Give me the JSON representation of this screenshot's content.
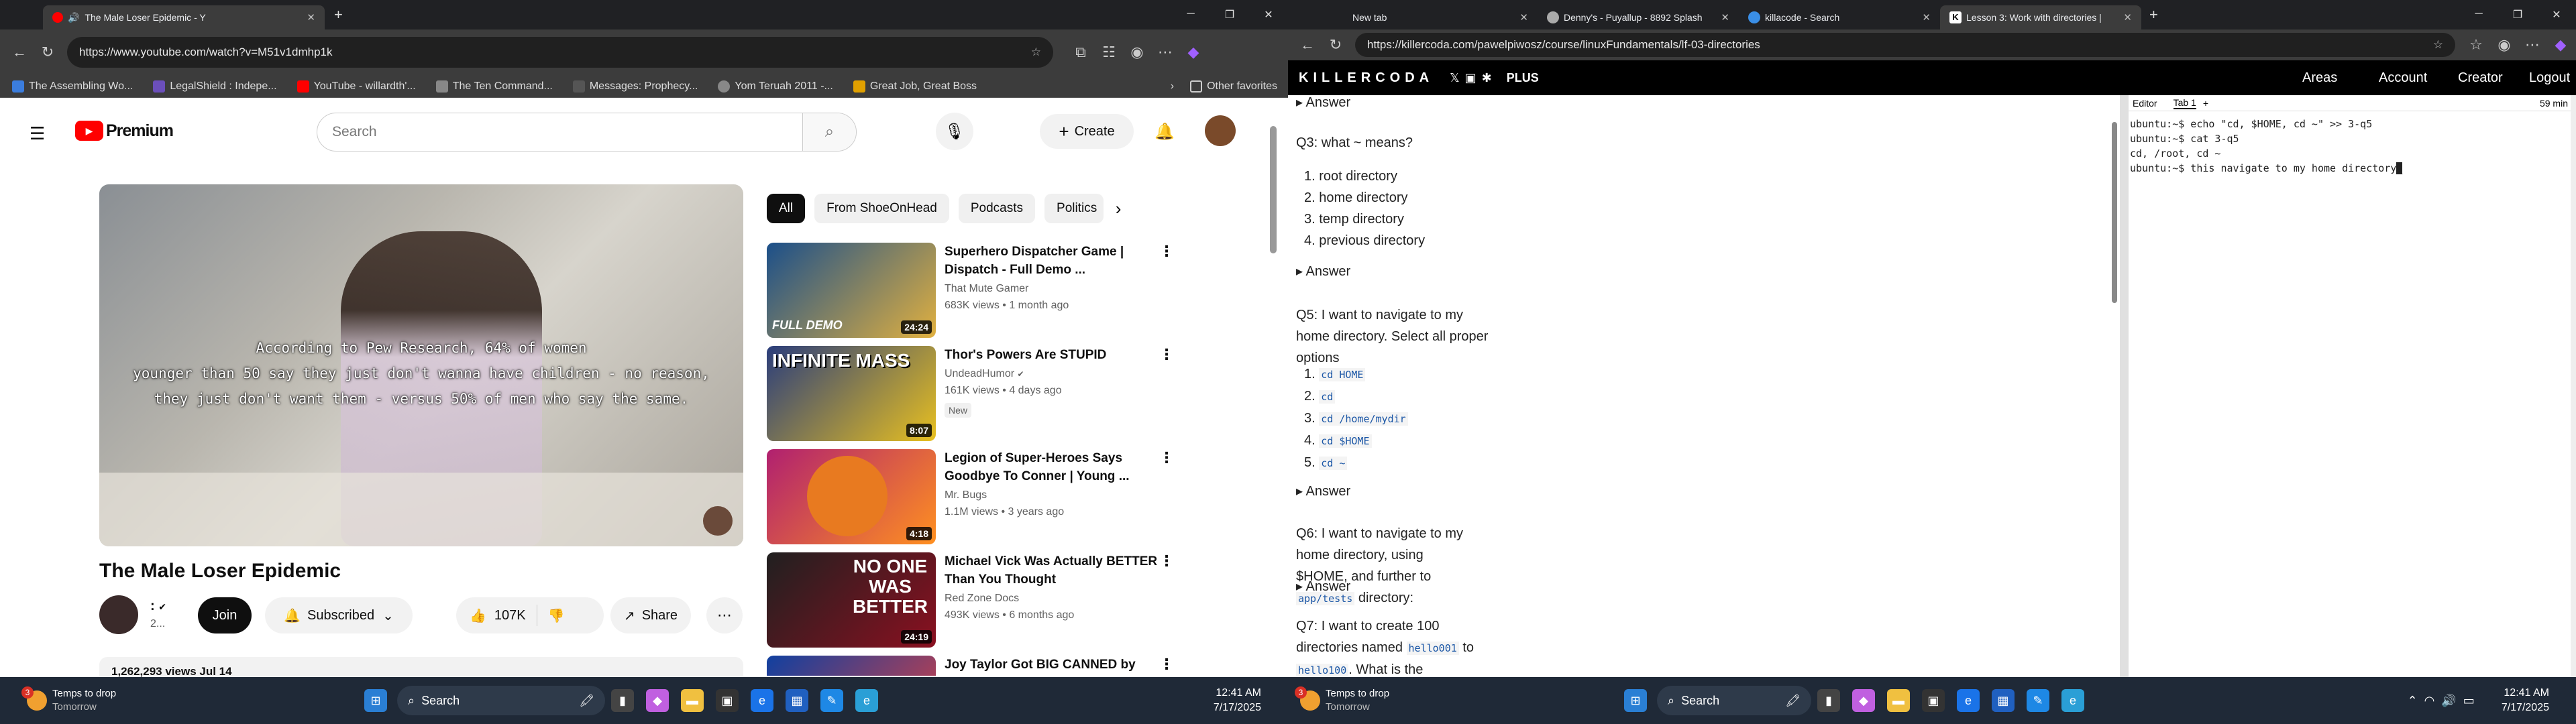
{
  "left_browser": {
    "tab_title": "The Male Loser Epidemic - Y",
    "url": "https://www.youtube.com/watch?v=M51v1dmhp1k",
    "favorites": [
      {
        "label": "The Assembling Wo...",
        "color": "#3b7ddd"
      },
      {
        "label": "LegalShield : Indepe...",
        "color": "#6b4fbb"
      },
      {
        "label": "YouTube - willardth'...",
        "color": "#ff0000"
      },
      {
        "label": "The Ten Command...",
        "color": "#888888"
      },
      {
        "label": "Messages: Prophecy...",
        "color": "#555555"
      },
      {
        "label": "Yom Teruah 2011 -...",
        "color": "#888888"
      },
      {
        "label": "Great Job, Great Boss",
        "color": "#e0a000"
      }
    ],
    "other_favorites": "Other favorites"
  },
  "youtube": {
    "logo": "Premium",
    "search_placeholder": "Search",
    "create_label": "Create",
    "caption_lines": [
      "According to Pew Research, 64% of women",
      "younger than 50 say they just don't wanna have children - no reason,",
      "they just don't want them - versus 50% of men who say the same."
    ],
    "video_title": "The Male Loser Epidemic",
    "channel_name": ":",
    "channel_subs": "2...",
    "join_label": "Join",
    "subscribed_label": "Subscribed",
    "likes": "107K",
    "share_label": "Share",
    "views_partial": "1,262,293 views  Jul 14",
    "chips": [
      "All",
      "From ShoeOnHead",
      "Podcasts",
      "Politics"
    ],
    "recommendations": [
      {
        "title": "Superhero Dispatcher Game | Dispatch - Full Demo ...",
        "channel": "That Mute Gamer",
        "meta": "683K views • 1 month ago",
        "duration": "24:24",
        "thumb_text": "FULL DEMO",
        "colors": [
          "#1b4f8a",
          "#e0b040"
        ]
      },
      {
        "title": "Thor's Powers Are STUPID",
        "channel": "UndeadHumor",
        "meta": "161K views • 4 days ago",
        "duration": "8:07",
        "thumb_text": "INFINITE MASS",
        "colors": [
          "#2a3d7c",
          "#e8c020"
        ],
        "badge": "New"
      },
      {
        "title": "Legion of Super-Heroes Says Goodbye To Conner | Young ...",
        "channel": "Mr. Bugs",
        "meta": "1.1M views • 3 years ago",
        "duration": "4:18",
        "thumb_text": "",
        "colors": [
          "#b02070",
          "#ff9020"
        ]
      },
      {
        "title": "Michael Vick Was Actually BETTER Than You Thought",
        "channel": "Red Zone Docs",
        "meta": "493K views • 6 months ago",
        "duration": "24:19",
        "thumb_text": "NO ONE WAS BETTER",
        "colors": [
          "#202020",
          "#8a1020"
        ]
      },
      {
        "title": "Joy Taylor Got BIG CANNED by",
        "channel": "",
        "meta": "",
        "duration": "",
        "thumb_text": "",
        "colors": [
          "#1040a0",
          "#e04040"
        ]
      }
    ]
  },
  "right_browser": {
    "tabs": [
      "New tab",
      "Denny's - Puyallup - 8892 Splash",
      "killacode - Search",
      "Lesson 3: Work with directories |"
    ],
    "url": "https://killercoda.com/pawelpiwosz/course/linuxFundamentals/lf-03-directories"
  },
  "killercoda": {
    "logo": "KILLERCODA",
    "plus": "PLUS",
    "menu": [
      "Areas",
      "Account",
      "Creator",
      "Logout"
    ],
    "answer_label": "Answer",
    "q3": "Q3: what ~ means?",
    "q3_options": [
      "root directory",
      "home directory",
      "temp directory",
      "previous directory"
    ],
    "q5": "Q5: I want to navigate to my home directory. Select all proper options",
    "q5_options": [
      "cd HOME",
      "cd",
      "cd /home/mydir",
      "cd $HOME",
      "cd ~"
    ],
    "q6_a": "Q6: I want to navigate to my home directory, using",
    "q6_b": "$HOME, and further to",
    "q6_code": "app/tests",
    "q6_c": "directory:",
    "q7_a": "Q7: I want to create 100 directories named",
    "q7_code1": "hello001",
    "q7_b": "to",
    "q7_code2": "hello100",
    "q7_c": ". What is the command?",
    "editor_tab": "Editor",
    "term_tab": "Tab 1",
    "timer": "59 min",
    "terminal_lines": [
      "ubuntu:~$ echo \"cd, $HOME, cd ~\" >> 3-q5",
      "ubuntu:~$ cat 3-q5",
      "cd, /root, cd ~",
      "ubuntu:~$ this navigate to my home directory"
    ]
  },
  "taskbar_left": {
    "weather_title": "Temps to drop",
    "weather_sub": "Tomorrow",
    "search": "Search",
    "time": "12:41 AM",
    "date": "7/17/2025",
    "badge": "3"
  },
  "taskbar_right": {
    "weather_title": "Temps to drop",
    "weather_sub": "Tomorrow",
    "search": "Search",
    "time": "12:41 AM",
    "date": "7/17/2025",
    "badge": "3"
  }
}
